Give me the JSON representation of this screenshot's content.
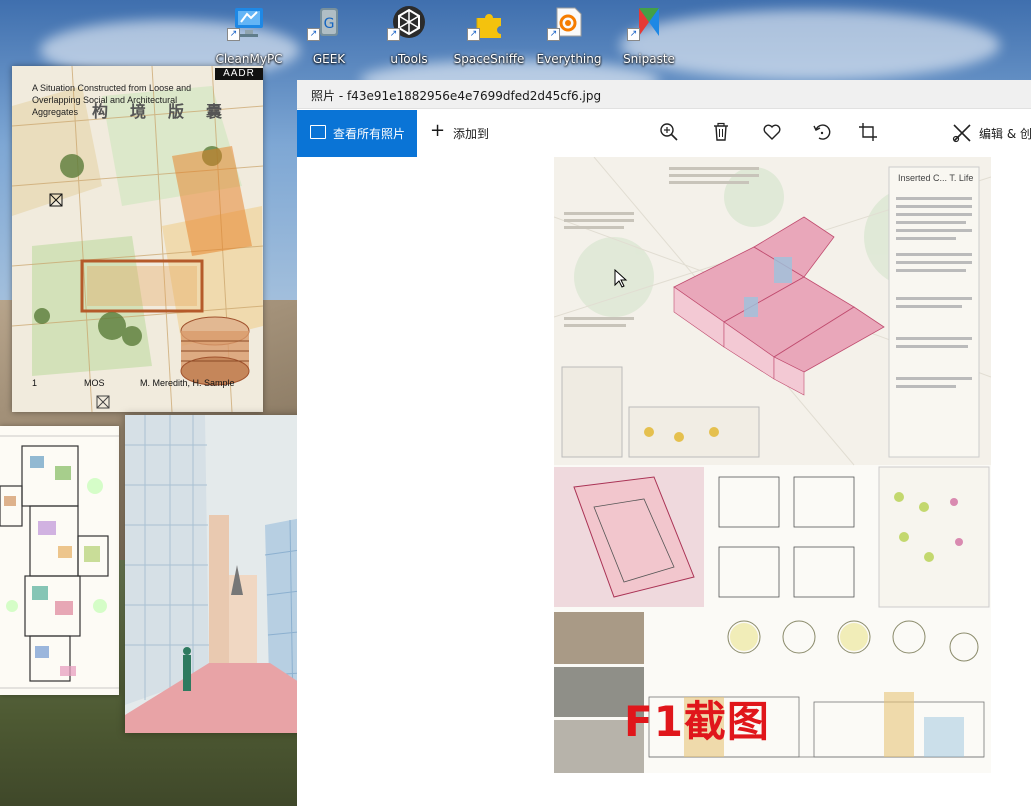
{
  "desktop": {
    "icons": [
      {
        "label": "CleanMyPC",
        "icon": "cleanmypc-icon"
      },
      {
        "label": "GEEK",
        "icon": "geek-icon"
      },
      {
        "label": "uTools",
        "icon": "utools-icon"
      },
      {
        "label": "SpaceSniffe",
        "icon": "spacesniffer-icon"
      },
      {
        "label": "Everything",
        "icon": "everything-icon"
      },
      {
        "label": "Snipaste",
        "icon": "snipaste-icon"
      }
    ]
  },
  "book_cover": {
    "publisher": "AADR",
    "subtitle": "A Situation Constructed from Loose and Overlapping Social and Architectural Aggregates",
    "chinese_chars": [
      "构",
      "境",
      "版",
      "囊"
    ],
    "number": "1",
    "author_left": "MOS",
    "author_right": "M. Meredith, H. Sample"
  },
  "photos_app": {
    "title": "照片 - f43e91e1882956e4e7699dfed2d45cf6.jpg",
    "toolbar": {
      "see_all": "查看所有照片",
      "add_to": "添加到",
      "edit": "编辑 & 创"
    },
    "poster": {
      "title": "Inserted C... T. Life"
    }
  },
  "overlay": {
    "hotkey_text": "F1截图",
    "color": "#e0161b"
  },
  "colors": {
    "accent": "#0a74d6"
  }
}
